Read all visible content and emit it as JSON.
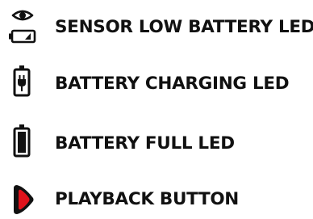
{
  "legend": {
    "items": [
      {
        "label": "SENSOR LOW BATTERY LED",
        "icon": "eye-low-battery-icon"
      },
      {
        "label": "BATTERY CHARGING LED",
        "icon": "battery-charging-icon"
      },
      {
        "label": "BATTERY FULL LED",
        "icon": "battery-full-icon"
      },
      {
        "label": "PLAYBACK BUTTON",
        "icon": "playback-button-icon"
      }
    ]
  },
  "colors": {
    "ink": "#111111",
    "accent": "#e0121b"
  }
}
